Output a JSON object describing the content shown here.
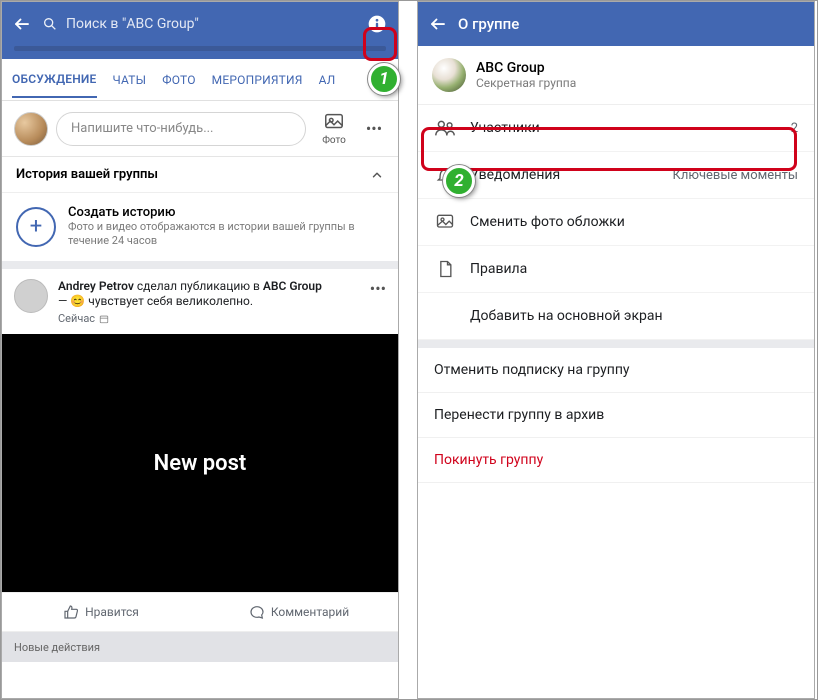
{
  "left": {
    "search_placeholder": "Поиск в \"ABC Group\"",
    "tabs": [
      "ОБСУЖДЕНИЕ",
      "ЧАТЫ",
      "ФОТО",
      "МЕРОПРИЯТИЯ",
      "АЛ"
    ],
    "compose_placeholder": "Напишите что-нибудь...",
    "photo_label": "Фото",
    "story_section_title": "История вашей группы",
    "story_title": "Создать историю",
    "story_subtitle": "Фото и видео отображаются в истории вашей группы в течение 24 часов",
    "post": {
      "author": "Andrey Petrov",
      "middle": " сделал публикацию в ",
      "group": "ABC Group",
      "feeling_prefix": "— ",
      "feeling_emoji": "😊",
      "feeling_text": " чувствует себя великолепно.",
      "time": "Сейчас",
      "body": "New post"
    },
    "like_label": "Нравится",
    "comment_label": "Комментарий",
    "new_actions": "Новые действия"
  },
  "right": {
    "header_title": "О группе",
    "group_name": "ABC Group",
    "group_type": "Секретная группа",
    "menu": {
      "members": {
        "label": "Участники",
        "value": "2"
      },
      "notifications": {
        "label": "Уведомления",
        "value": "Ключевые моменты"
      },
      "cover": {
        "label": "Сменить фото обложки"
      },
      "rules": {
        "label": "Правила"
      },
      "add_home": {
        "label": "Добавить на основной экран"
      }
    },
    "actions": {
      "unsubscribe": "Отменить подписку на группу",
      "archive": "Перенести группу в архив",
      "leave": "Покинуть группу"
    }
  },
  "markers": {
    "one": "1",
    "two": "2"
  }
}
